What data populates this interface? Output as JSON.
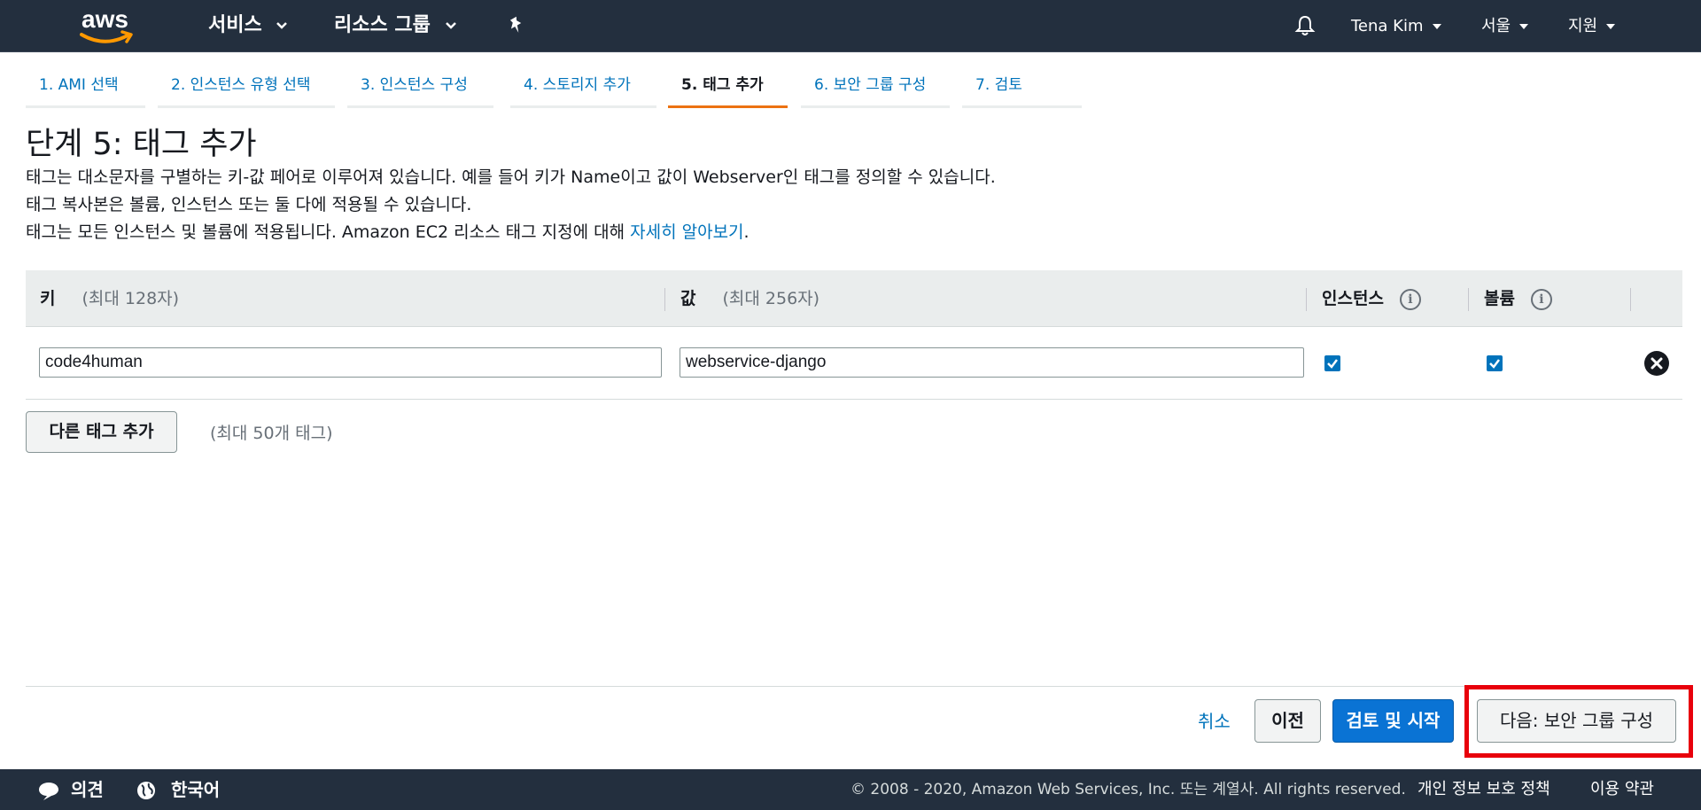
{
  "topnav": {
    "logo_text": "aws",
    "services_label": "서비스",
    "resource_groups_label": "리소스 그룹",
    "user_label": "Tena Kim",
    "region_label": "서울",
    "support_label": "지원"
  },
  "steps": [
    {
      "label": "1. AMI 선택"
    },
    {
      "label": "2. 인스턴스 유형 선택"
    },
    {
      "label": "3. 인스턴스 구성"
    },
    {
      "label": "4. 스토리지 추가"
    },
    {
      "label": "5. 태그 추가",
      "active": true
    },
    {
      "label": "6. 보안 그룹 구성"
    },
    {
      "label": "7. 검토"
    }
  ],
  "page": {
    "title": "단계 5: 태그 추가",
    "desc_line1": "태그는 대소문자를 구별하는 키-값 페어로 이루어져 있습니다. 예를 들어 키가 Name이고 값이 Webserver인 태그를 정의할 수 있습니다.",
    "desc_line2": "태그 복사본은 볼륨, 인스턴스 또는 둘 다에 적용될 수 있습니다.",
    "desc_line3_prefix": "태그는 모든 인스턴스 및 볼륨에 적용됩니다. Amazon EC2 리소스 태그 지정에 대해",
    "desc_line3_link": "자세히 알아보기",
    "desc_line3_suffix": "."
  },
  "table": {
    "columns": {
      "key_label": "키",
      "key_hint": "(최대 128자)",
      "value_label": "값",
      "value_hint": "(최대 256자)",
      "instances_label": "인스턴스",
      "volumes_label": "볼륨"
    },
    "rows": [
      {
        "key": "code4human",
        "value": "webservice-django",
        "instances": true,
        "volumes": true
      }
    ]
  },
  "add_tag": {
    "button_label": "다른 태그 추가",
    "hint": "(최대 50개 태그)"
  },
  "actions": {
    "cancel_label": "취소",
    "prev_label": "이전",
    "review_label": "검토 및 시작",
    "next_label": "다음: 보안 그룹 구성"
  },
  "footer": {
    "feedback_label": "의견",
    "language_label": "한국어",
    "copyright": "© 2008 - 2020, Amazon Web Services, Inc. 또는 계열사. All rights reserved.",
    "privacy_label": "개인 정보 보호 정책",
    "terms_label": "이용 약관"
  },
  "colors": {
    "nav_bg": "#232f3e",
    "link": "#0073bb",
    "active_tab": "#ec7211",
    "primary_button": "#0a73d4",
    "highlight": "#e8000b"
  },
  "icons": [
    "aws-smile-icon",
    "chevron-down-icon",
    "pin-icon",
    "bell-icon",
    "info-icon",
    "checkmark-icon",
    "remove-icon",
    "speech-bubble-icon",
    "globe-icon"
  ]
}
